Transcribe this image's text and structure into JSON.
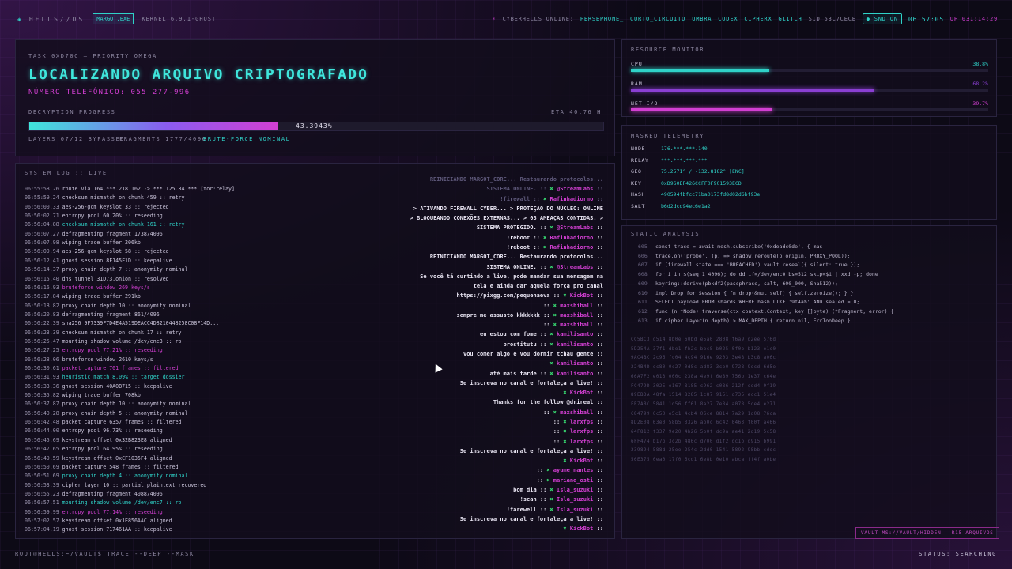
{
  "topbar": {
    "logo": "HELLS//OS",
    "process": "MARGOT.EXE",
    "kernel": "KERNEL 6.9.1-GHOST",
    "online_label": "CYBERHELLS ONLINE:",
    "online_users": [
      "PERSEPHONE_",
      "CURTO_CIRCUITO",
      "UMBRA",
      "CODEX",
      "CIPHERX",
      "GLITCH"
    ],
    "sid": "SID 53C7CECE",
    "snd": "SND ON",
    "clock": "06:57:05",
    "uptime": "UP 031:14:29"
  },
  "task": {
    "tag": "TASK 0XD70C — PRIORITY OMEGA",
    "title": "LOCALIZANDO ARQUIVO CRIPTOGRAFADO",
    "phone": "NÚMERO TELEFÔNICO: 055 277-996",
    "progress_label": "DECRYPTION PROGRESS",
    "eta": "ETA 40.76 H",
    "progress_text": "43.3943%",
    "progress_fraction": 0.433943,
    "layers": "LAYERS 07/12 BYPASSED",
    "fragments": "FRAGMENTS 1777/4096",
    "bruteforce": "BRUTE-FORCE NOMINAL"
  },
  "syslog": {
    "title": "SYSTEM LOG :: LIVE",
    "lines": [
      {
        "t": "06:55:58.26",
        "m": "route via 164.***.218.162 -> ***.125.84.*** [tor:relay]",
        "c": ""
      },
      {
        "t": "06:55:59.24",
        "m": "checksum mismatch on chunk 459 :: retry",
        "c": ""
      },
      {
        "t": "06:56:00.33",
        "m": "aes-256-gcm keyslot 33 :: rejected",
        "c": ""
      },
      {
        "t": "06:56:02.71",
        "m": "entropy pool 60.20% :: reseeding",
        "c": ""
      },
      {
        "t": "06:56:04.88",
        "m": "checksum mismatch on chunk 161 :: retry",
        "c": "teal"
      },
      {
        "t": "06:56:07.27",
        "m": "defragmenting fragment 1738/4096",
        "c": ""
      },
      {
        "t": "06:56:07.98",
        "m": "wiping trace buffer 206kb",
        "c": ""
      },
      {
        "t": "06:56:09.94",
        "m": "aes-256-gcm keyslot 58 :: rejected",
        "c": ""
      },
      {
        "t": "06:56:12.41",
        "m": "ghost session 8F145F1D :: keepalive",
        "c": ""
      },
      {
        "t": "06:56:14.37",
        "m": "proxy chain depth 7 :: anonymity nominal",
        "c": ""
      },
      {
        "t": "06:56:15.40",
        "m": "dns tunnel 31D73.onion :: resolved",
        "c": ""
      },
      {
        "t": "06:56:16.93",
        "m": "bruteforce window 269 keys/s",
        "c": "mag"
      },
      {
        "t": "06:56:17.84",
        "m": "wiping trace buffer 291kb",
        "c": ""
      },
      {
        "t": "06:56:18.82",
        "m": "proxy chain depth 10 :: anonymity nominal",
        "c": ""
      },
      {
        "t": "06:56:20.83",
        "m": "defragmenting fragment 861/4096",
        "c": ""
      },
      {
        "t": "06:56:22.39",
        "m": "sha256 9F7339F7D4E4A519DEACC4D8210448258C08F14D...",
        "c": ""
      },
      {
        "t": "06:56:23.39",
        "m": "checksum mismatch on chunk 17 :: retry",
        "c": ""
      },
      {
        "t": "06:56:25.47",
        "m": "mounting shadow volume /dev/enc3 :: ro",
        "c": ""
      },
      {
        "t": "06:56:27.25",
        "m": "entropy pool 77.21% :: reseeding",
        "c": "mag"
      },
      {
        "t": "06:56:28.06",
        "m": "bruteforce window 2610 keys/s",
        "c": ""
      },
      {
        "t": "06:56:30.61",
        "m": "packet capture 701 frames :: filtered",
        "c": "mag"
      },
      {
        "t": "06:56:31.93",
        "m": "heuristic match 8.09% :: target dossier",
        "c": "teal"
      },
      {
        "t": "06:56:33.36",
        "m": "ghost session 40A0B715 :: keepalive",
        "c": ""
      },
      {
        "t": "06:56:35.82",
        "m": "wiping trace buffer 708kb",
        "c": ""
      },
      {
        "t": "06:56:37.87",
        "m": "proxy chain depth 10 :: anonymity nominal",
        "c": ""
      },
      {
        "t": "06:56:40.28",
        "m": "proxy chain depth 5 :: anonymity nominal",
        "c": ""
      },
      {
        "t": "06:56:42.48",
        "m": "packet capture 6357 frames :: filtered",
        "c": ""
      },
      {
        "t": "06:56:44.00",
        "m": "entropy pool 96.73% :: reseeding",
        "c": ""
      },
      {
        "t": "06:56:45.69",
        "m": "keystream offset 0x32B823E8 aligned",
        "c": ""
      },
      {
        "t": "06:56:47.65",
        "m": "entropy pool 64.95% :: reseeding",
        "c": ""
      },
      {
        "t": "06:56:49.59",
        "m": "keystream offset 0xCF1035F4 aligned",
        "c": ""
      },
      {
        "t": "06:56:50.69",
        "m": "packet capture 548 frames :: filtered",
        "c": ""
      },
      {
        "t": "06:56:51.69",
        "m": "proxy chain depth 4 :: anonymity nominal",
        "c": "teal"
      },
      {
        "t": "06:56:53.39",
        "m": "cipher layer 10 :: partial plaintext recovered",
        "c": ""
      },
      {
        "t": "06:56:55.23",
        "m": "defragmenting fragment 4088/4096",
        "c": ""
      },
      {
        "t": "06:56:57.51",
        "m": "mounting shadow volume /dev/enc7 :: ro",
        "c": "teal"
      },
      {
        "t": "06:56:59.99",
        "m": "entropy pool 77.14% :: reseeding",
        "c": "mag"
      },
      {
        "t": "06:57:02.57",
        "m": "keystream offset 0x1E856AAC aligned",
        "c": ""
      },
      {
        "t": "06:57:04.19",
        "m": "ghost session 717461AA :: keepalive",
        "c": ""
      }
    ],
    "chat": [
      {
        "m": "REINICIANDO MARGOT_CORE... Restaurando protocolos...",
        "u": "",
        "c": "dim"
      },
      {
        "m": "SISTEMA ONLINE. ::",
        "u": "@StreamLabs",
        "c": "dim"
      },
      {
        "m": "!firewall ::",
        "u": "Rafinhadiorno",
        "c": "dim"
      },
      {
        "m": "> ATIVANDO FIREWALL CYBER... > PROTEÇÃO DO NÚCLEO: ONLINE",
        "u": "",
        "c": ""
      },
      {
        "m": "> BLOQUEANDO CONEXÕES EXTERNAS... > 03 AMEAÇAS CONTIDAS. >",
        "u": "",
        "c": ""
      },
      {
        "m": "SISTEMA PROTEGIDO. ::",
        "u": "@StreamLabs",
        "c": ""
      },
      {
        "m": "!reboot ::",
        "u": "Rafinhadiorno",
        "c": ""
      },
      {
        "m": "!reboot ::",
        "u": "Rafinhadiorno",
        "c": ""
      },
      {
        "m": "REINICIANDO MARGOT_CORE... Restaurando protocolos...",
        "u": "",
        "c": ""
      },
      {
        "m": "SISTEMA ONLINE. ::",
        "u": "@StreamLabs",
        "c": ""
      },
      {
        "m": "Se você tá curtindo a live, pode mandar sua mensagem na",
        "u": "",
        "c": ""
      },
      {
        "m": "tela e ainda dar aquela força pro canal",
        "u": "",
        "c": ""
      },
      {
        "m": "https://pixgg.com/pequenaeva ::",
        "u": "KickBot",
        "c": ""
      },
      {
        "m": "::",
        "u": "maxshiball",
        "c": ""
      },
      {
        "m": "sempre me assusto kkkkkkk ::",
        "u": "maxshiball",
        "c": ""
      },
      {
        "m": "::",
        "u": "maxshiball",
        "c": ""
      },
      {
        "m": "eu estou com fome ::",
        "u": "kamilisanto",
        "c": ""
      },
      {
        "m": "prostitutu ::",
        "u": "kamilisanto",
        "c": ""
      },
      {
        "m": "vou comer algo e vou dormir tchau gente ::",
        "u": "",
        "c": ""
      },
      {
        "m": "",
        "u": "kamilisanto",
        "c": ""
      },
      {
        "m": "até mais tarde ::",
        "u": "kamilisanto",
        "c": ""
      },
      {
        "m": "Se inscreva no canal e fortaleça a live! ::",
        "u": "",
        "c": ""
      },
      {
        "m": "",
        "u": "KickBot",
        "c": ""
      },
      {
        "m": "Thanks for the follow @drireal ::",
        "u": "",
        "c": ""
      },
      {
        "m": "::",
        "u": "maxshiball",
        "c": ""
      },
      {
        "m": "::",
        "u": "larxfps",
        "c": ""
      },
      {
        "m": "::",
        "u": "larxfps",
        "c": ""
      },
      {
        "m": "::",
        "u": "larxfps",
        "c": ""
      },
      {
        "m": "Se inscreva no canal e fortaleça a live! ::",
        "u": "",
        "c": ""
      },
      {
        "m": "",
        "u": "KickBot",
        "c": ""
      },
      {
        "m": "::",
        "u": "ayume_nantes",
        "c": ""
      },
      {
        "m": "::",
        "u": "mariane_osti",
        "c": ""
      },
      {
        "m": "bom dia ::",
        "u": "Isla_suzuki",
        "c": ""
      },
      {
        "m": "!scan ::",
        "u": "Isla_suzuki",
        "c": ""
      },
      {
        "m": "!farewell ::",
        "u": "Isla_suzuki",
        "c": ""
      },
      {
        "m": "Se inscreva no canal e fortaleça a live! ::",
        "u": "",
        "c": ""
      },
      {
        "m": "",
        "u": "KickBot",
        "c": ""
      }
    ]
  },
  "resource": {
    "title": "RESOURCE MONITOR",
    "rows": [
      {
        "name": "CPU",
        "val": "38.8%",
        "frac": 0.388,
        "color": "#2fd2c8"
      },
      {
        "name": "RAM",
        "val": "68.2%",
        "frac": 0.682,
        "color": "#8a3fd2"
      },
      {
        "name": "NET I/O",
        "val": "39.7%",
        "frac": 0.397,
        "color": "#d23fd2"
      }
    ]
  },
  "telemetry": {
    "title": "MASKED TELEMETRY",
    "rows": [
      {
        "k": "NODE",
        "v": "176.***.***.140"
      },
      {
        "k": "RELAY",
        "v": "***.***.***.***"
      },
      {
        "k": "GEO",
        "v": "75.2571° / -132.8182° [ENC]"
      },
      {
        "k": "KEY",
        "v": "0xD960EF426CCFF0F901593ECD"
      },
      {
        "k": "HASH",
        "v": "490594fbfcc71ba0173fd8d02d6bf93e"
      },
      {
        "k": "SALT",
        "v": "b6d2dcd94ec6e1a2"
      }
    ]
  },
  "static": {
    "title": "STATIC ANALYSIS",
    "code": [
      {
        "n": "605",
        "l": "const trace = await mesh.subscribe('0xdeadc0de', { mas"
      },
      {
        "n": "606",
        "l": "trace.on('probe', (p) => shadow.reroute(p.origin, PROXY_POOL));"
      },
      {
        "n": "607",
        "l": "if (firewall.state === 'BREACHED') vault.reseal({ silent: true });"
      },
      {
        "n": "608",
        "l": "for i in $(seq 1 4096); do dd if=/dev/enc0 bs=512 skip=$i | xxd -p; done"
      },
      {
        "n": "609",
        "l": "keyring::derive(pbkdf2(passphrase, salt, 600_000, Sha512));"
      },
      {
        "n": "610",
        "l": "impl Drop for Session { fn drop(&mut self) { self.zeroize(); } }"
      },
      {
        "n": "611",
        "l": "SELECT payload FROM shards WHERE hash LIKE '9f4a%' AND sealed = 0;"
      },
      {
        "n": "612",
        "l": "func (n *Node) traverse(ctx context.Context, key []byte) (*Fragment, error) {"
      },
      {
        "n": "613",
        "l": "if cipher.Layer(n.depth) > MAX_DEPTH { return nil, ErrTooDeep }"
      }
    ],
    "hex": [
      "CC5BC3 d514 8b0e 60bd e5a0 2808 f6a9 d2ee 576d",
      "5D254A 37f1 dbe1 fb2c bbc8 b025 0f0b b123 e1c0",
      "9AC4BC 2c96 fc04 4c94 916e 9203 3e48 b3c8 a06c",
      "224B4D ec80 0c27 0d8c ad83 3cb0 9728 9ecd 6d5e",
      "66A7F2 e013 000c 238a 4e9f 6e89 756b 1e37 c64e",
      "FC479D 3025 e167 8185 c962 c086 212f ced4 9f19",
      "89EBDA 48fa 1514 8285 1c87 9151 d735 ecc1 51e4",
      "FE7ABC 5841 1d56 ff61 8a27 7e84 a078 5ce4 e271",
      "C84799 0c50 e5c1 4cb4 06ce 8814 7a29 1d08 76ca",
      "8D2E08 63e0 58b5 3326 ab0c 6c42 0463 f00f a466",
      "64F812 f337 9e20 4b26 5b0f dc9a ae41 2d19 5c58",
      "6FF474 b17b 3c2b 486c d700 d1f2 dc1b d915 b991",
      "239894 588d 25ee 254c 2dd0 1541 5892 98bb cdec",
      "56E375 0ea0 17f0 6cd1 6e8b 0e10 abca ff4f a0be"
    ],
    "vault": "VAULT MS://VAULT/HIDDEN — R15 ARQUIVOS"
  },
  "bottombar": {
    "prompt": "ROOT@HELLS:~/VAULT$ TRACE --DEEP --MASK",
    "status": "STATUS: SEARCHING"
  }
}
